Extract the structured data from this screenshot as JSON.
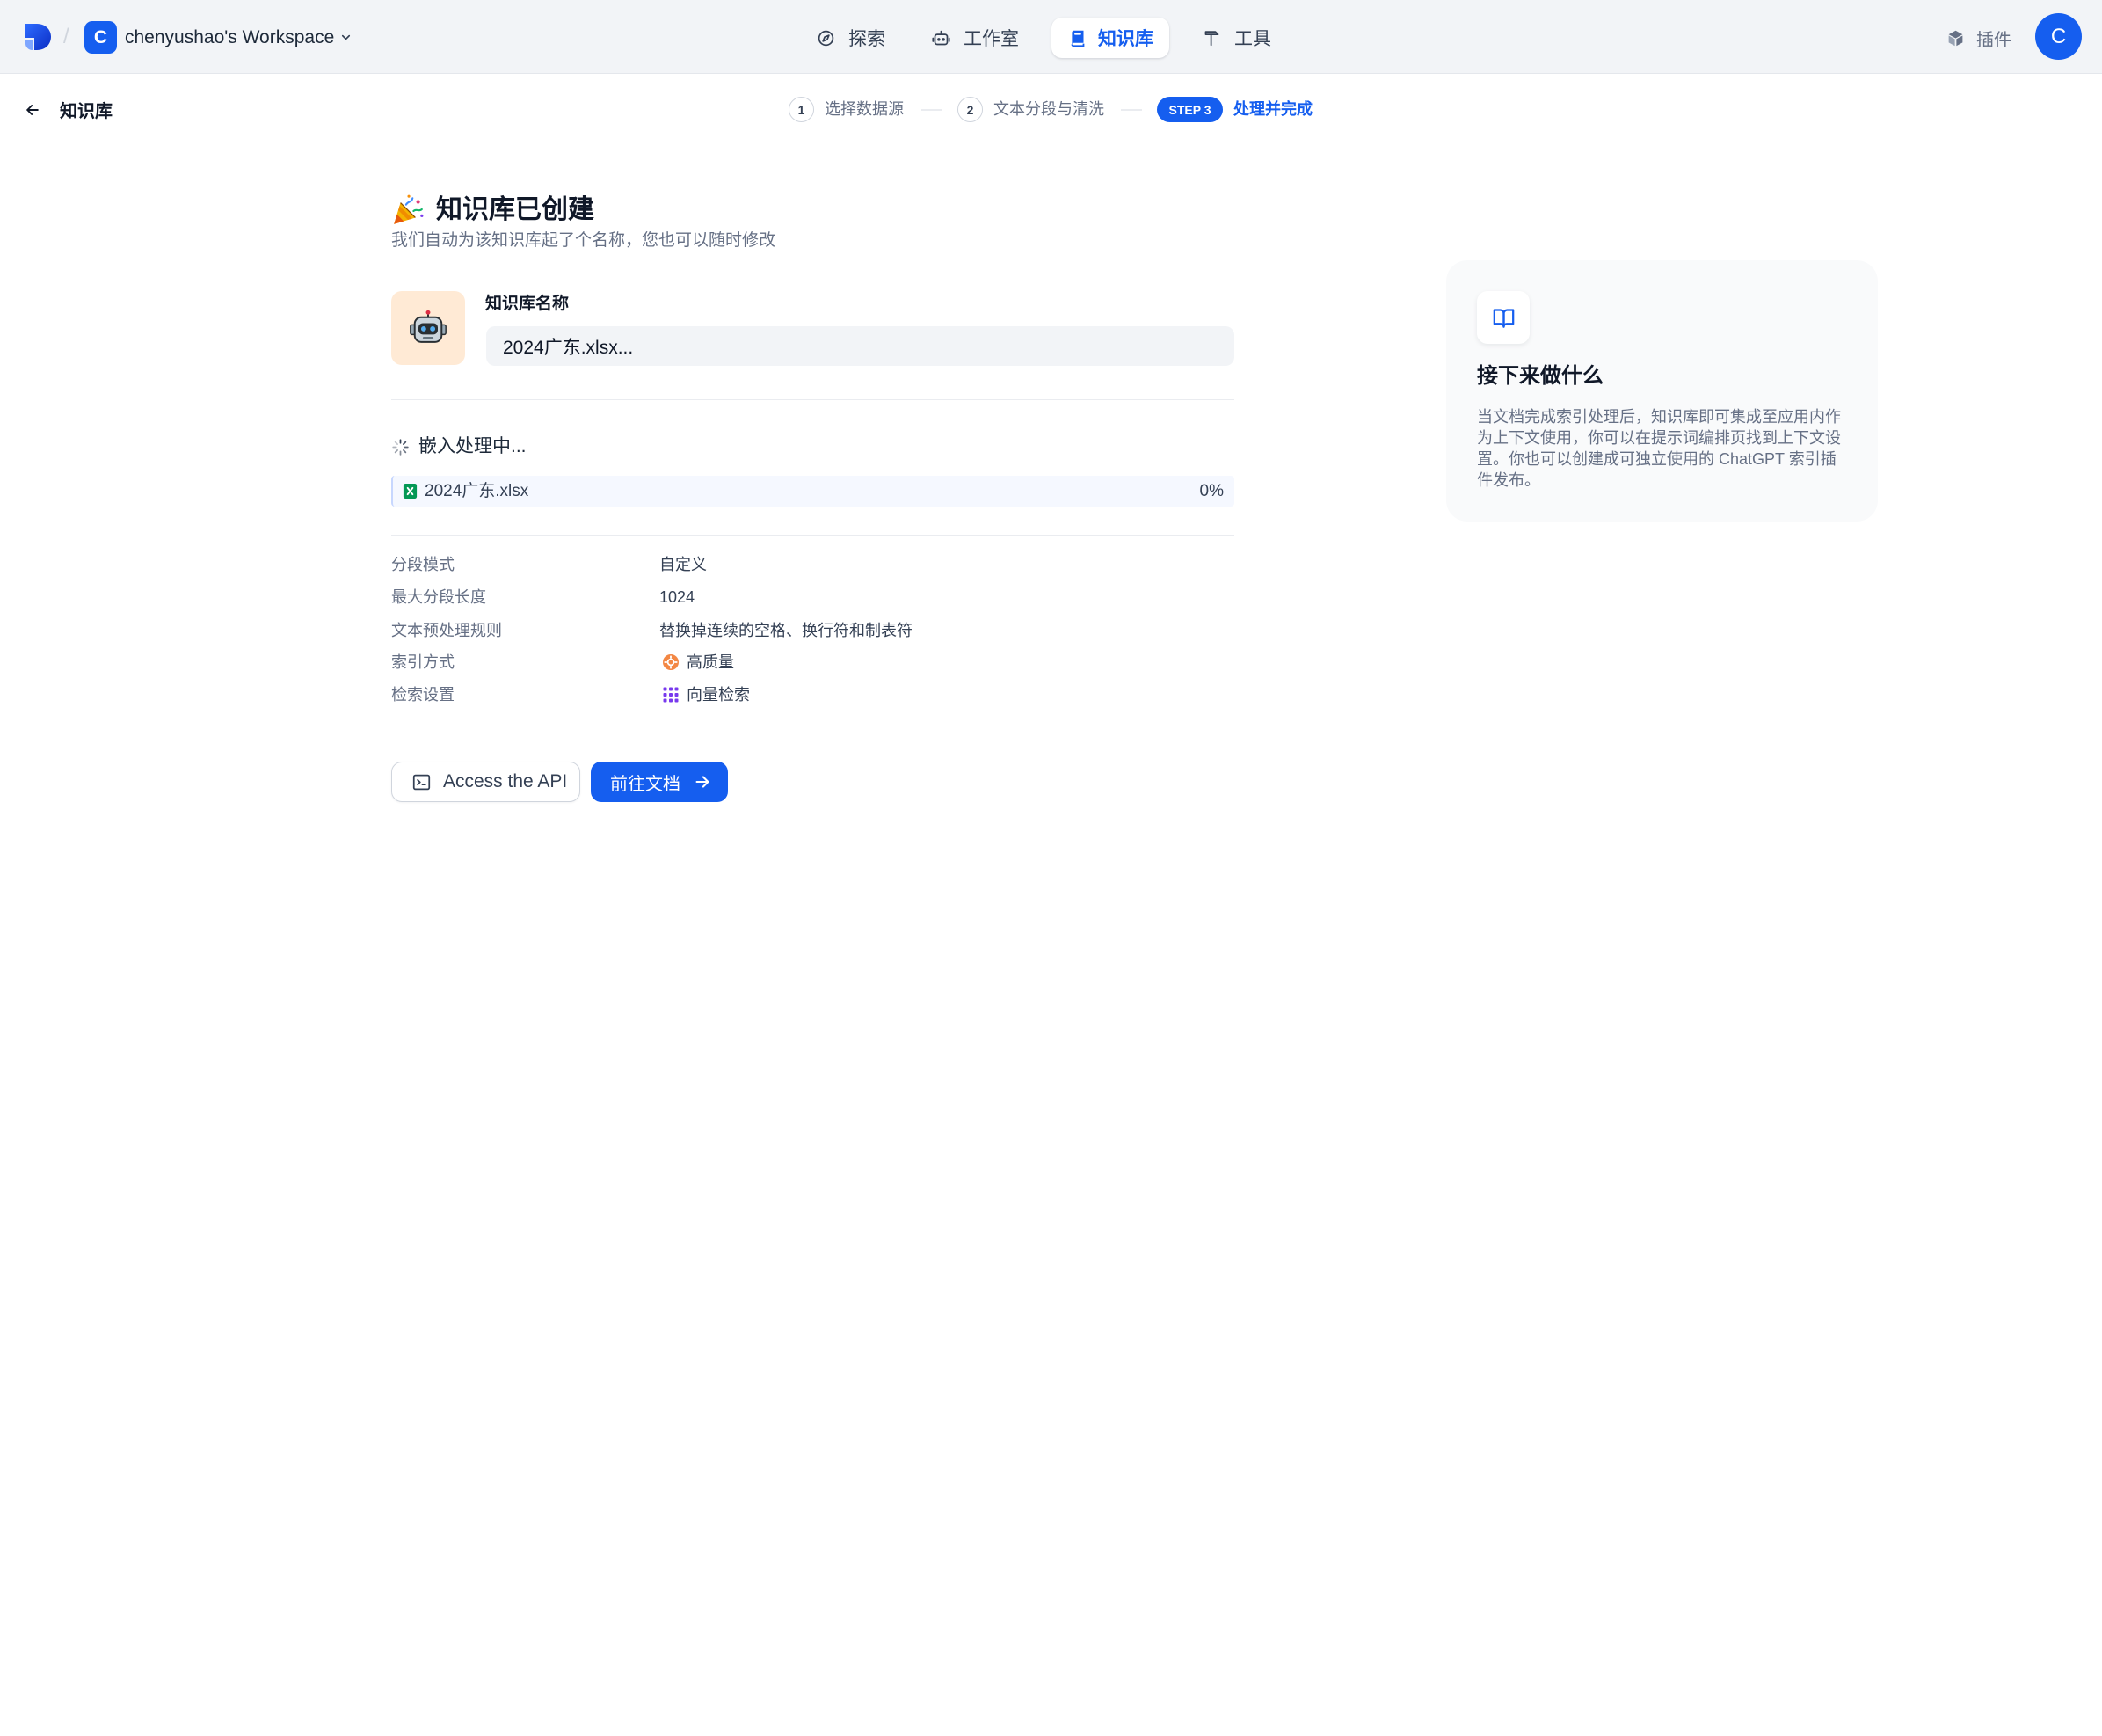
{
  "header": {
    "separator": "/",
    "workspace": {
      "initial": "C",
      "name": "chenyushao's Workspace"
    },
    "nav": [
      {
        "label": "探索",
        "icon": "compass-icon",
        "active": false
      },
      {
        "label": "工作室",
        "icon": "robot-icon",
        "active": false
      },
      {
        "label": "知识库",
        "icon": "book-icon",
        "active": true
      },
      {
        "label": "工具",
        "icon": "tools-icon",
        "active": false
      }
    ],
    "plugins": {
      "label": "插件",
      "icon": "cube-icon"
    },
    "avatar_initial": "C"
  },
  "subheader": {
    "back_label": "知识库",
    "steps": [
      {
        "number": "1",
        "label": "选择数据源",
        "active": false
      },
      {
        "number": "2",
        "label": "文本分段与清洗",
        "active": false
      },
      {
        "number": "STEP 3",
        "label": "处理并完成",
        "active": true
      }
    ]
  },
  "main": {
    "title_icon": "party-popper-icon",
    "title": "知识库已创建",
    "subtitle": "我们自动为该知识库起了个名称，您也可以随时修改",
    "dataset_icon": "robot-face-icon",
    "name_label": "知识库名称",
    "name_value": "2024广东.xlsx...",
    "embedding_status": "嵌入处理中...",
    "file": {
      "icon": "excel-file-icon",
      "name": "2024广东.xlsx",
      "progress": 0,
      "progress_label": "0%"
    },
    "settings": [
      {
        "label": "分段模式",
        "value": "自定义"
      },
      {
        "label": "最大分段长度",
        "value": "1024"
      },
      {
        "label": "文本预处理规则",
        "value": "替换掉连续的空格、换行符和制表符"
      },
      {
        "label": "索引方式",
        "value": "高质量",
        "icon": "high-quality-icon"
      },
      {
        "label": "检索设置",
        "value": "向量检索",
        "icon": "vector-search-icon"
      }
    ],
    "actions": {
      "api_label": "Access the API",
      "docs_label": "前往文档"
    }
  },
  "next_steps_card": {
    "icon": "book-open-icon",
    "title": "接下来做什么",
    "body": "当文档完成索引处理后，知识库即可集成至应用内作为上下文使用，你可以在提示词编排页找到上下文设置。你也可以创建成可独立使用的 ChatGPT 索引插件发布。"
  },
  "colors": {
    "primary": "#155EEF",
    "header_background": "#F2F4F7",
    "dataset_icon_background": "#FFEAD5",
    "card_background": "#F9FAFB"
  }
}
